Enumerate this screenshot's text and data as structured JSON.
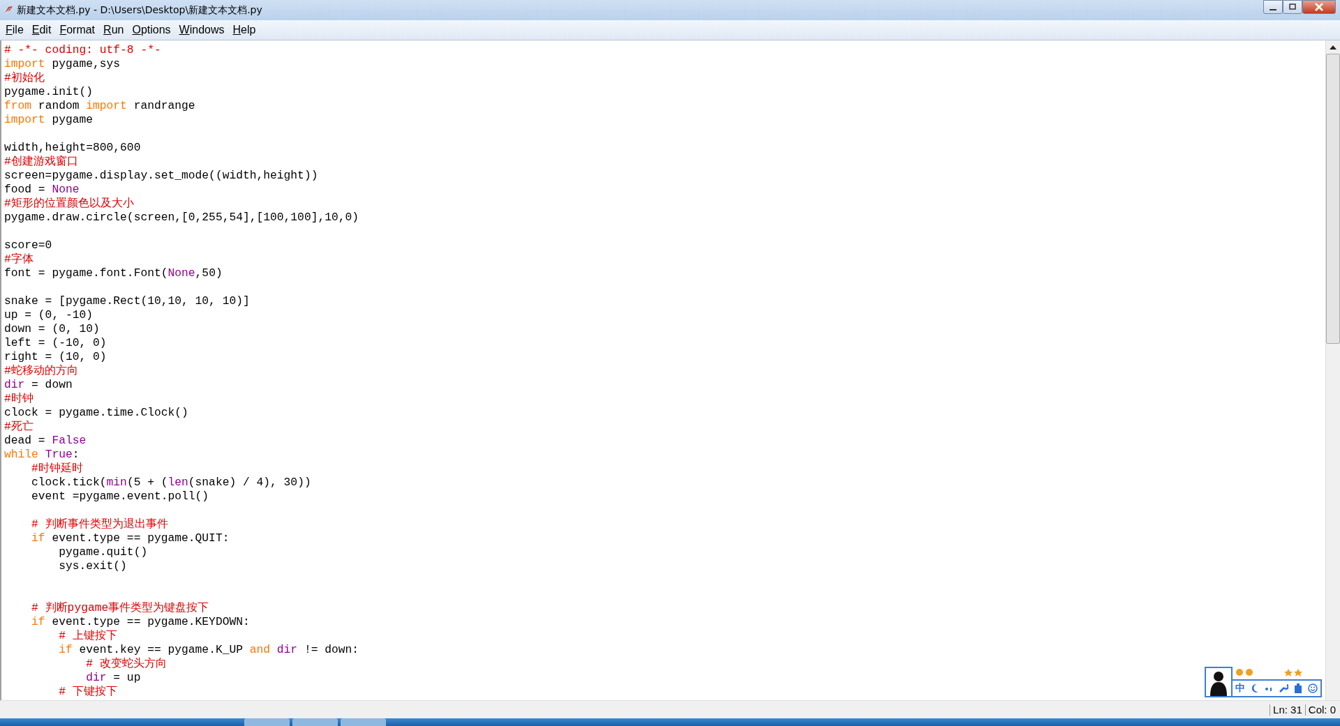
{
  "window": {
    "title": "新建文本文档.py - D:\\Users\\Desktop\\新建文本文档.py"
  },
  "menu": [
    "File",
    "Edit",
    "Format",
    "Run",
    "Options",
    "Windows",
    "Help"
  ],
  "editor": {
    "lines": [
      {
        "tokens": [
          {
            "kind": "comment",
            "text": "# -*- coding: utf-8 -*-"
          }
        ]
      },
      {
        "tokens": [
          {
            "kind": "keyword",
            "text": "import"
          },
          {
            "kind": "code",
            "text": " pygame,sys"
          }
        ]
      },
      {
        "tokens": [
          {
            "kind": "comment",
            "text": "#初始化"
          }
        ]
      },
      {
        "tokens": [
          {
            "kind": "code",
            "text": "pygame.init()"
          }
        ]
      },
      {
        "tokens": [
          {
            "kind": "keyword",
            "text": "from"
          },
          {
            "kind": "code",
            "text": " random "
          },
          {
            "kind": "keyword",
            "text": "import"
          },
          {
            "kind": "code",
            "text": " randrange"
          }
        ]
      },
      {
        "tokens": [
          {
            "kind": "keyword",
            "text": "import"
          },
          {
            "kind": "code",
            "text": " pygame"
          }
        ]
      },
      {
        "kind": "blank"
      },
      {
        "tokens": [
          {
            "kind": "code",
            "text": "width,height=800,600"
          }
        ]
      },
      {
        "tokens": [
          {
            "kind": "comment",
            "text": "#创建游戏窗口"
          }
        ]
      },
      {
        "tokens": [
          {
            "kind": "code",
            "text": "screen=pygame.display.set_mode((width,height))"
          }
        ]
      },
      {
        "tokens": [
          {
            "kind": "code",
            "text": "food = "
          },
          {
            "kind": "builtin",
            "text": "None"
          }
        ]
      },
      {
        "tokens": [
          {
            "kind": "comment",
            "text": "#矩形的位置颜色以及大小"
          }
        ]
      },
      {
        "tokens": [
          {
            "kind": "code",
            "text": "pygame.draw.circle(screen,[0,255,54],[100,100],10,0)"
          }
        ]
      },
      {
        "kind": "blank"
      },
      {
        "tokens": [
          {
            "kind": "code",
            "text": "score=0"
          }
        ]
      },
      {
        "tokens": [
          {
            "kind": "comment",
            "text": "#字体"
          }
        ]
      },
      {
        "tokens": [
          {
            "kind": "code",
            "text": "font = pygame.font.Font("
          },
          {
            "kind": "builtin",
            "text": "None"
          },
          {
            "kind": "code",
            "text": ",50)"
          }
        ]
      },
      {
        "kind": "blank"
      },
      {
        "tokens": [
          {
            "kind": "code",
            "text": "snake = [pygame.Rect(10,10, 10, 10)]"
          }
        ]
      },
      {
        "tokens": [
          {
            "kind": "code",
            "text": "up = (0, -10)"
          }
        ]
      },
      {
        "tokens": [
          {
            "kind": "code",
            "text": "down = (0, 10)"
          }
        ]
      },
      {
        "tokens": [
          {
            "kind": "code",
            "text": "left = (-10, 0)"
          }
        ]
      },
      {
        "tokens": [
          {
            "kind": "code",
            "text": "right = (10, 0)"
          }
        ]
      },
      {
        "tokens": [
          {
            "kind": "comment",
            "text": "#蛇移动的方向"
          }
        ]
      },
      {
        "tokens": [
          {
            "kind": "builtin",
            "text": "dir"
          },
          {
            "kind": "code",
            "text": " = down"
          }
        ]
      },
      {
        "tokens": [
          {
            "kind": "comment",
            "text": "#时钟"
          }
        ]
      },
      {
        "tokens": [
          {
            "kind": "code",
            "text": "clock = pygame.time.Clock()"
          }
        ]
      },
      {
        "tokens": [
          {
            "kind": "comment",
            "text": "#死亡"
          }
        ]
      },
      {
        "tokens": [
          {
            "kind": "code",
            "text": "dead = "
          },
          {
            "kind": "builtin",
            "text": "False"
          }
        ]
      },
      {
        "tokens": [
          {
            "kind": "keyword",
            "text": "while"
          },
          {
            "kind": "builtin",
            "text": " True"
          },
          {
            "kind": "code",
            "text": ":"
          }
        ]
      },
      {
        "tokens": [
          {
            "kind": "comment",
            "text": "    #时钟延时"
          }
        ]
      },
      {
        "tokens": [
          {
            "kind": "code",
            "text": "    clock.tick("
          },
          {
            "kind": "builtin",
            "text": "min"
          },
          {
            "kind": "code",
            "text": "(5 + ("
          },
          {
            "kind": "builtin",
            "text": "len"
          },
          {
            "kind": "code",
            "text": "(snake) / 4), 30))"
          }
        ]
      },
      {
        "tokens": [
          {
            "kind": "code",
            "text": "    event =pygame.event.poll()"
          }
        ]
      },
      {
        "kind": "blank"
      },
      {
        "tokens": [
          {
            "kind": "comment",
            "text": "    # 判断事件类型为退出事件"
          }
        ]
      },
      {
        "tokens": [
          {
            "kind": "keyword",
            "text": "    if"
          },
          {
            "kind": "code",
            "text": " event.type == pygame.QUIT:"
          }
        ]
      },
      {
        "tokens": [
          {
            "kind": "code",
            "text": "        pygame.quit()"
          }
        ]
      },
      {
        "tokens": [
          {
            "kind": "code",
            "text": "        sys.exit()"
          }
        ]
      },
      {
        "kind": "blank"
      },
      {
        "kind": "blank"
      },
      {
        "tokens": [
          {
            "kind": "comment",
            "text": "    # 判断pygame事件类型为键盘按下"
          }
        ]
      },
      {
        "tokens": [
          {
            "kind": "keyword",
            "text": "    if"
          },
          {
            "kind": "code",
            "text": " event.type == pygame.KEYDOWN:"
          }
        ]
      },
      {
        "tokens": [
          {
            "kind": "comment",
            "text": "        # 上键按下"
          }
        ]
      },
      {
        "tokens": [
          {
            "kind": "keyword",
            "text": "        if"
          },
          {
            "kind": "code",
            "text": " event.key == pygame.K_UP "
          },
          {
            "kind": "keyword",
            "text": "and"
          },
          {
            "kind": "builtin",
            "text": " dir"
          },
          {
            "kind": "code",
            "text": " != down:"
          }
        ]
      },
      {
        "tokens": [
          {
            "kind": "comment",
            "text": "            # 改变蛇头方向"
          }
        ]
      },
      {
        "tokens": [
          {
            "kind": "builtin",
            "text": "            dir"
          },
          {
            "kind": "code",
            "text": " = up"
          }
        ]
      },
      {
        "tokens": [
          {
            "kind": "comment",
            "text": "        # 下键按下"
          }
        ]
      }
    ]
  },
  "ime": {
    "language": "中"
  },
  "status_bar": {
    "line": "Ln: 31",
    "column": "Col: 0"
  }
}
